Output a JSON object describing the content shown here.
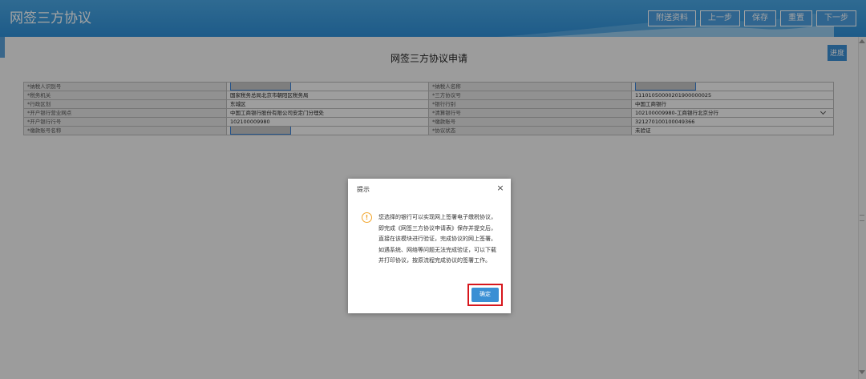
{
  "header": {
    "title": "网签三方协议",
    "buttons": [
      "附送资料",
      "上一步",
      "保存",
      "重置",
      "下一步"
    ]
  },
  "form": {
    "title": "网签三方协议申请",
    "progress_label": "进度",
    "rows": [
      {
        "l1": "*纳税人识别号",
        "v1": "",
        "l2": "*纳税人名称",
        "v2": ""
      },
      {
        "l1": "*税务机关",
        "v1": "国家税务总局北京市朝阳区税务局",
        "l2": "*三方协议号",
        "v2": "11101050000201900000025"
      },
      {
        "l1": "*行政区划",
        "v1": "东城区",
        "l2": "*银行行别",
        "v2": "中国工商银行"
      },
      {
        "l1": "*开户银行营业网点",
        "v1": "中国工商银行股份有限公司安定门分理处",
        "l2": "*清算银行号",
        "v2": "102100009980-工商银行北京分行"
      },
      {
        "l1": "*开户银行行号",
        "v1": "102100009980",
        "l2": "*缴款账号",
        "v2": "321270100100049366"
      },
      {
        "l1": "*缴款账号名称",
        "v1": "",
        "l2": "*协议状态",
        "v2": "未验证"
      }
    ]
  },
  "dialog": {
    "title": "提示",
    "close_label": "×",
    "icon_symbol": "!",
    "message": "您选择的银行可以实现网上签署电子缴税协议，即完成《网签三方协议申请表》保存并提交后，直接在该模块进行验证，完成协议的网上签署。如遇系统、网络等问题无法完成验证，可以下载并打印协议，按原流程完成协议的签署工作。",
    "ok_label": "确定"
  },
  "colors": {
    "header_blue": "#2f8fd6",
    "accent_blue": "#3a8fd4",
    "highlight_red": "#d7161c",
    "warning_orange": "#f2a52b"
  }
}
